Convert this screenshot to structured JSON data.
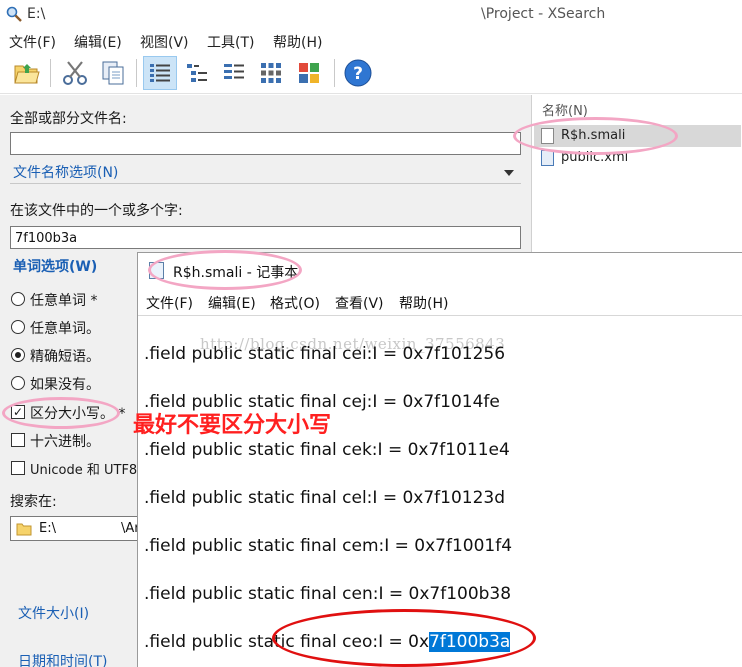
{
  "titlebar": {
    "path": "E:\\",
    "title": "\\Project - XSearch"
  },
  "menu": {
    "file": "文件(F)",
    "edit": "编辑(E)",
    "view": "视图(V)",
    "tools": "工具(T)",
    "help": "帮助(H)"
  },
  "toolbar": {
    "buttons": [
      "open-folder-icon",
      "scissors-icon",
      "copy-icon",
      "details-view-icon",
      "tree-view-icon",
      "list-view-icon",
      "grid-view-icon",
      "thumbnail-view-icon",
      "help-icon"
    ]
  },
  "left": {
    "filename_label": "全部或部分文件名:",
    "filename_value": "",
    "filename_options": "文件名称选项(N)",
    "content_label": "在该文件中的一个或多个字:",
    "content_value": "7f100b3a",
    "word_options": "单词选项(W)",
    "options": [
      {
        "label": "任意单词 *",
        "type": "radio",
        "checked": false
      },
      {
        "label": "任意单词。",
        "type": "radio",
        "checked": false
      },
      {
        "label": "精确短语。",
        "type": "radio",
        "checked": true
      },
      {
        "label": "如果没有。",
        "type": "radio",
        "checked": false
      },
      {
        "label": "区分大小写。 *",
        "type": "check",
        "checked": true
      },
      {
        "label": "十六进制。",
        "type": "check",
        "checked": false
      },
      {
        "label": "Unicode 和 UTF8.",
        "type": "check",
        "checked": false
      }
    ],
    "search_in_label": "搜索在:",
    "search_in_value": "E:\\",
    "search_in_suffix": "\\Ar",
    "file_size_link": "文件大小(I)",
    "date_time_link": "日期和时间(T)"
  },
  "right": {
    "column_header": "名称(N)",
    "files": [
      {
        "name": "R$h.smali",
        "selected": true
      },
      {
        "name": "public.xml",
        "selected": false
      }
    ]
  },
  "annotation": {
    "note": "最好不要区分大小写"
  },
  "notepad": {
    "title": "R$h.smali - 记事本",
    "menu": {
      "file": "文件(F)",
      "edit": "编辑(E)",
      "format": "格式(O)",
      "view": "查看(V)",
      "help": "帮助(H)"
    },
    "watermark": "http://blog.csdn.net/weixin_37556843",
    "lines": [
      ".field public static final cei:I = 0x7f101256",
      ".field public static final cej:I = 0x7f1014fe",
      ".field public static final cek:I = 0x7f1011e4",
      ".field public static final cel:I = 0x7f10123d",
      ".field public static final cem:I = 0x7f1001f4",
      ".field public static final cen:I = 0x7f100b38"
    ],
    "last_line_prefix": ".field public static final ceo:I = 0x",
    "last_line_highlight": "7f100b3a",
    "selection_color": "#0078d7"
  }
}
